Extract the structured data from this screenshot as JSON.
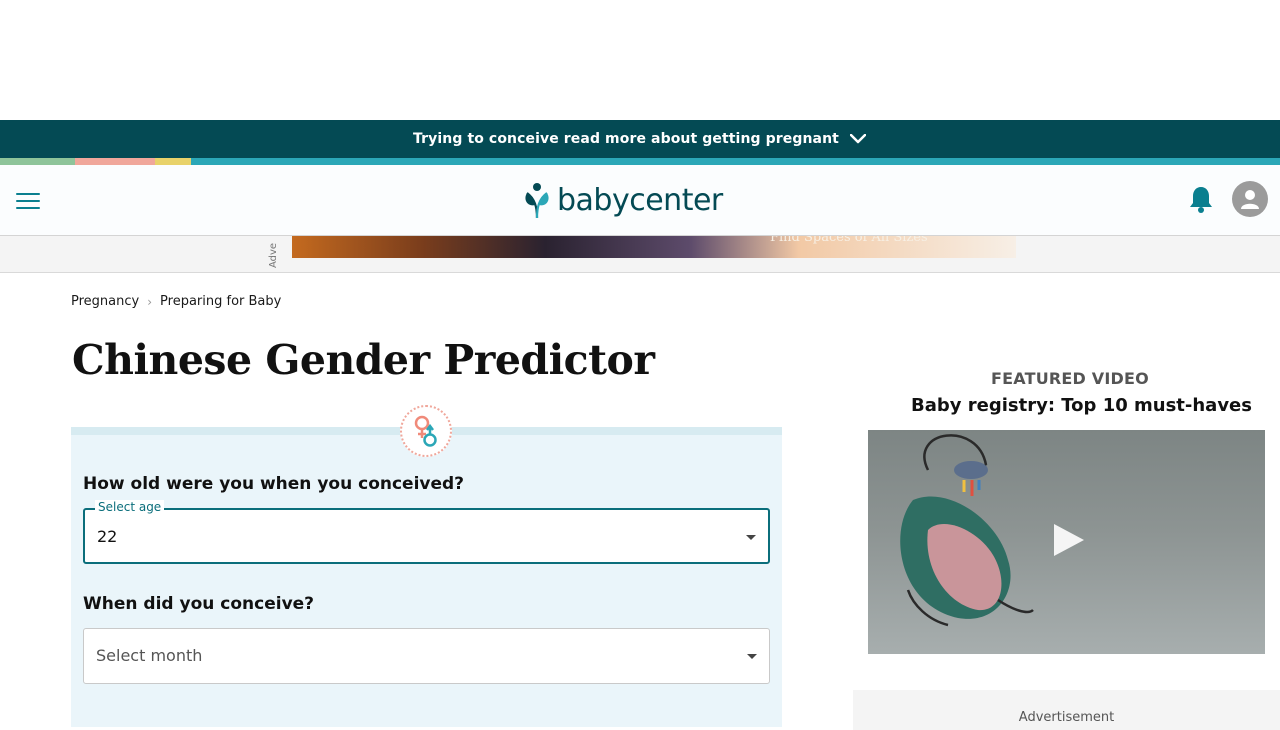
{
  "promo": {
    "text": "Trying to conceive read more about getting pregnant",
    "chevron_icon": "chevron-down-icon"
  },
  "header": {
    "logo_text": "babycenter",
    "menu_icon": "hamburger-menu-icon",
    "bell_icon": "bell-icon",
    "profile_icon": "user-avatar-icon",
    "brand_color": "#044a54",
    "accent_color": "#0a7f8f"
  },
  "ad_strip": {
    "label": "Adve",
    "caption": "Find Spaces of All Sizes"
  },
  "breadcrumb": {
    "items": [
      "Pregnancy",
      "Preparing for Baby"
    ]
  },
  "page": {
    "title": "Chinese Gender Predictor"
  },
  "form": {
    "q1": {
      "label": "How old were you when you conceived?",
      "legend": "Select age",
      "value": "22"
    },
    "q2": {
      "label": "When did you conceive?",
      "placeholder": "Select month"
    }
  },
  "sidebar": {
    "featured_label": "FEATURED VIDEO",
    "video_title": "Baby registry: Top 10 must-haves",
    "advertisement_label": "Advertisement"
  },
  "colors": {
    "promo_bg": "#044a54",
    "form_bg": "#eaf5fa",
    "select_border_active": "#0b6e7b"
  }
}
